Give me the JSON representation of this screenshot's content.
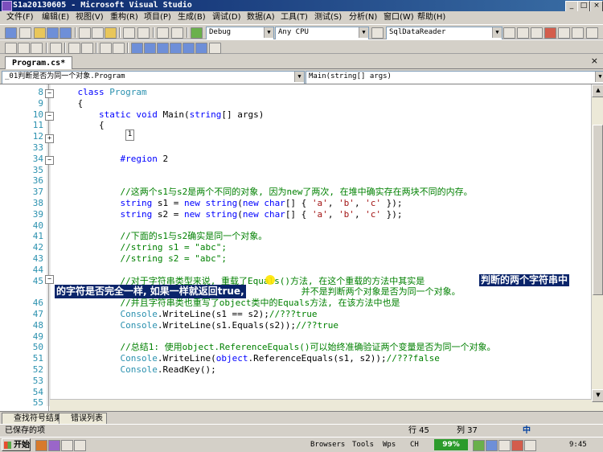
{
  "window": {
    "title": "S1a20130605 - Microsoft Visual Studio",
    "minimize": "_",
    "maximize": "□",
    "close": "×"
  },
  "menu": [
    "文件(F)",
    "编辑(E)",
    "视图(V)",
    "重构(R)",
    "项目(P)",
    "生成(B)",
    "调试(D)",
    "数据(A)",
    "工具(T)",
    "测试(S)",
    "分析(N)",
    "窗口(W)",
    "帮助(H)"
  ],
  "toolbar": {
    "config": "Debug",
    "platform": "Any CPU",
    "find": "SqlDataReader"
  },
  "tab": {
    "label": "Program.cs*",
    "close": "×"
  },
  "nav": {
    "type": "_01判断是否为同一个对象.Program",
    "member": "Main(string[] args)"
  },
  "code_lines": [
    {
      "n": "8",
      "segments": [
        [
          "",
          "    "
        ],
        [
          "kw",
          "class "
        ],
        [
          "ty",
          "Program"
        ]
      ]
    },
    {
      "n": "9",
      "segments": [
        [
          "",
          "    {"
        ]
      ]
    },
    {
      "n": "10",
      "segments": [
        [
          "",
          "        "
        ],
        [
          "kw",
          "static void "
        ],
        [
          "",
          "Main("
        ],
        [
          "kw",
          "string"
        ],
        [
          "",
          "[] args)"
        ]
      ]
    },
    {
      "n": "11",
      "segments": [
        [
          "",
          "        {"
        ]
      ]
    },
    {
      "n": "12",
      "segments": [
        [
          "",
          "            "
        ]
      ]
    },
    {
      "n": "33",
      "segments": [
        [
          "",
          ""
        ]
      ]
    },
    {
      "n": "34",
      "segments": [
        [
          "",
          "            "
        ],
        [
          "kw",
          "#region "
        ],
        [
          "",
          "2"
        ]
      ]
    },
    {
      "n": "35",
      "segments": [
        [
          "",
          ""
        ]
      ]
    },
    {
      "n": "36",
      "segments": [
        [
          "",
          ""
        ]
      ]
    },
    {
      "n": "37",
      "segments": [
        [
          "",
          "            "
        ],
        [
          "cm",
          "//这两个s1与s2是两个不同的对象, 因为new了两次, 在堆中确实存在两块不同的内存。"
        ]
      ]
    },
    {
      "n": "38",
      "segments": [
        [
          "",
          "            "
        ],
        [
          "kw",
          "string "
        ],
        [
          "",
          "s1 = "
        ],
        [
          "kw",
          "new string"
        ],
        [
          "",
          "("
        ],
        [
          "kw",
          "new char"
        ],
        [
          "",
          "[] { "
        ],
        [
          "st",
          "'a'"
        ],
        [
          "",
          ", "
        ],
        [
          "st",
          "'b'"
        ],
        [
          "",
          ", "
        ],
        [
          "st",
          "'c'"
        ],
        [
          "",
          " });"
        ]
      ]
    },
    {
      "n": "39",
      "segments": [
        [
          "",
          "            "
        ],
        [
          "kw",
          "string "
        ],
        [
          "",
          "s2 = "
        ],
        [
          "kw",
          "new string"
        ],
        [
          "",
          "("
        ],
        [
          "kw",
          "new char"
        ],
        [
          "",
          "[] { "
        ],
        [
          "st",
          "'a'"
        ],
        [
          "",
          ", "
        ],
        [
          "st",
          "'b'"
        ],
        [
          "",
          ", "
        ],
        [
          "st",
          "'c'"
        ],
        [
          "",
          " });"
        ]
      ]
    },
    {
      "n": "40",
      "segments": [
        [
          "",
          ""
        ]
      ]
    },
    {
      "n": "41",
      "segments": [
        [
          "",
          "            "
        ],
        [
          "cm",
          "//下面的s1与s2确实是同一个对象。"
        ]
      ]
    },
    {
      "n": "42",
      "segments": [
        [
          "",
          "            "
        ],
        [
          "cm",
          "//string s1 = \"abc\";"
        ]
      ]
    },
    {
      "n": "43",
      "segments": [
        [
          "",
          "            "
        ],
        [
          "cm",
          "//string s2 = \"abc\";"
        ]
      ]
    },
    {
      "n": "44",
      "segments": [
        [
          "",
          ""
        ]
      ]
    },
    {
      "n": "45",
      "segments": [
        [
          "",
          "            "
        ],
        [
          "cm",
          "//对于字符串类型来说, 重载了Equals()方法, 在这个重载的方法中其实是"
        ]
      ]
    },
    {
      "n": "",
      "segments": [
        [
          "",
          "            "
        ],
        [
          "cm",
          "                                  并不是判断两个对象是否为同一个对象。"
        ]
      ]
    },
    {
      "n": "46",
      "segments": [
        [
          "",
          "            "
        ],
        [
          "cm",
          "//并且字符串类也重写了object类中的Equals方法, 在该方法中也是"
        ]
      ]
    },
    {
      "n": "47",
      "segments": [
        [
          "",
          "            "
        ],
        [
          "ty",
          "Console"
        ],
        [
          "",
          ".WriteLine(s1 == s2);"
        ],
        [
          "cm",
          "//???true"
        ]
      ]
    },
    {
      "n": "48",
      "segments": [
        [
          "",
          "            "
        ],
        [
          "ty",
          "Console"
        ],
        [
          "",
          ".WriteLine(s1.Equals(s2));"
        ],
        [
          "cm",
          "//??true"
        ]
      ]
    },
    {
      "n": "49",
      "segments": [
        [
          "",
          ""
        ]
      ]
    },
    {
      "n": "50",
      "segments": [
        [
          "",
          "            "
        ],
        [
          "cm",
          "//总结1: 使用object.ReferenceEquals()可以始终准确验证两个变量是否为同一个对象。"
        ]
      ]
    },
    {
      "n": "51",
      "segments": [
        [
          "",
          "            "
        ],
        [
          "ty",
          "Console"
        ],
        [
          "",
          ".WriteLine("
        ],
        [
          "kw",
          "object"
        ],
        [
          "",
          ".ReferenceEquals(s1, s2));"
        ],
        [
          "cm",
          "//???false"
        ]
      ]
    },
    {
      "n": "52",
      "segments": [
        [
          "",
          "            "
        ],
        [
          "ty",
          "Console"
        ],
        [
          "",
          ".ReadKey();"
        ]
      ]
    },
    {
      "n": "53",
      "segments": [
        [
          "",
          ""
        ]
      ]
    },
    {
      "n": "54",
      "segments": [
        [
          "",
          ""
        ]
      ]
    },
    {
      "n": "55",
      "segments": [
        [
          "",
          ""
        ]
      ]
    }
  ],
  "collapsed_region_marker": "1",
  "subtitle_line1": "判断的两个字符串中",
  "subtitle_line2": "的字符是否完全一样, 如果一样就返回true,",
  "bottom_tabs": [
    "查找符号结果",
    "错误列表"
  ],
  "status": {
    "left": "已保存的项",
    "line": "行 45",
    "col": "列 37",
    "ime": "中"
  },
  "taskbar": {
    "start": "开始",
    "browsers": "Browsers",
    "tools": "Tools",
    "wps": "Wps",
    "ch": "CH",
    "battery": "99%",
    "time": "9:45"
  }
}
